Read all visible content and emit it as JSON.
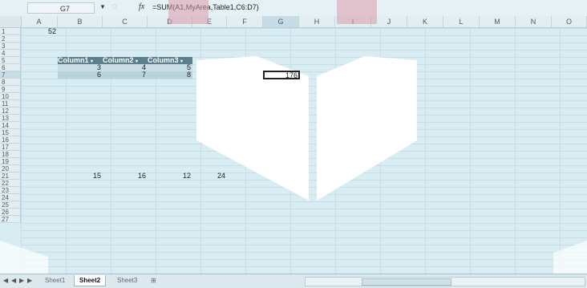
{
  "formula_bar": {
    "name_box": "G7",
    "fx_label": "fx",
    "formula": "=SUM(A1,MyArea,Table1,C6:D7)"
  },
  "columns": [
    "A",
    "B",
    "C",
    "D",
    "E",
    "F",
    "G",
    "H",
    "I",
    "J",
    "K",
    "L",
    "M",
    "N",
    "O"
  ],
  "rows": [
    "1",
    "2",
    "3",
    "4",
    "5",
    "6",
    "7",
    "8",
    "9",
    "10",
    "11",
    "12",
    "13",
    "14",
    "15",
    "16",
    "17",
    "18",
    "19",
    "20",
    "21",
    "22",
    "23",
    "24",
    "25",
    "26",
    "27"
  ],
  "cells": {
    "A1": "52",
    "B6": "3",
    "C6": "4",
    "D6": "5",
    "B7": "6",
    "C7": "7",
    "D7": "8",
    "G7": "176",
    "B16": "15",
    "C16": "16",
    "D16": "12",
    "E16": "24"
  },
  "table_headers": [
    "Column1",
    "Column2",
    "Column3"
  ],
  "sheet_tabs": [
    "Sheet1",
    "Sheet2",
    "Sheet3"
  ],
  "active_sheet": "Sheet2",
  "colors": {
    "accent": "#5b7f8c",
    "watermark_red": "#d99aa8"
  }
}
